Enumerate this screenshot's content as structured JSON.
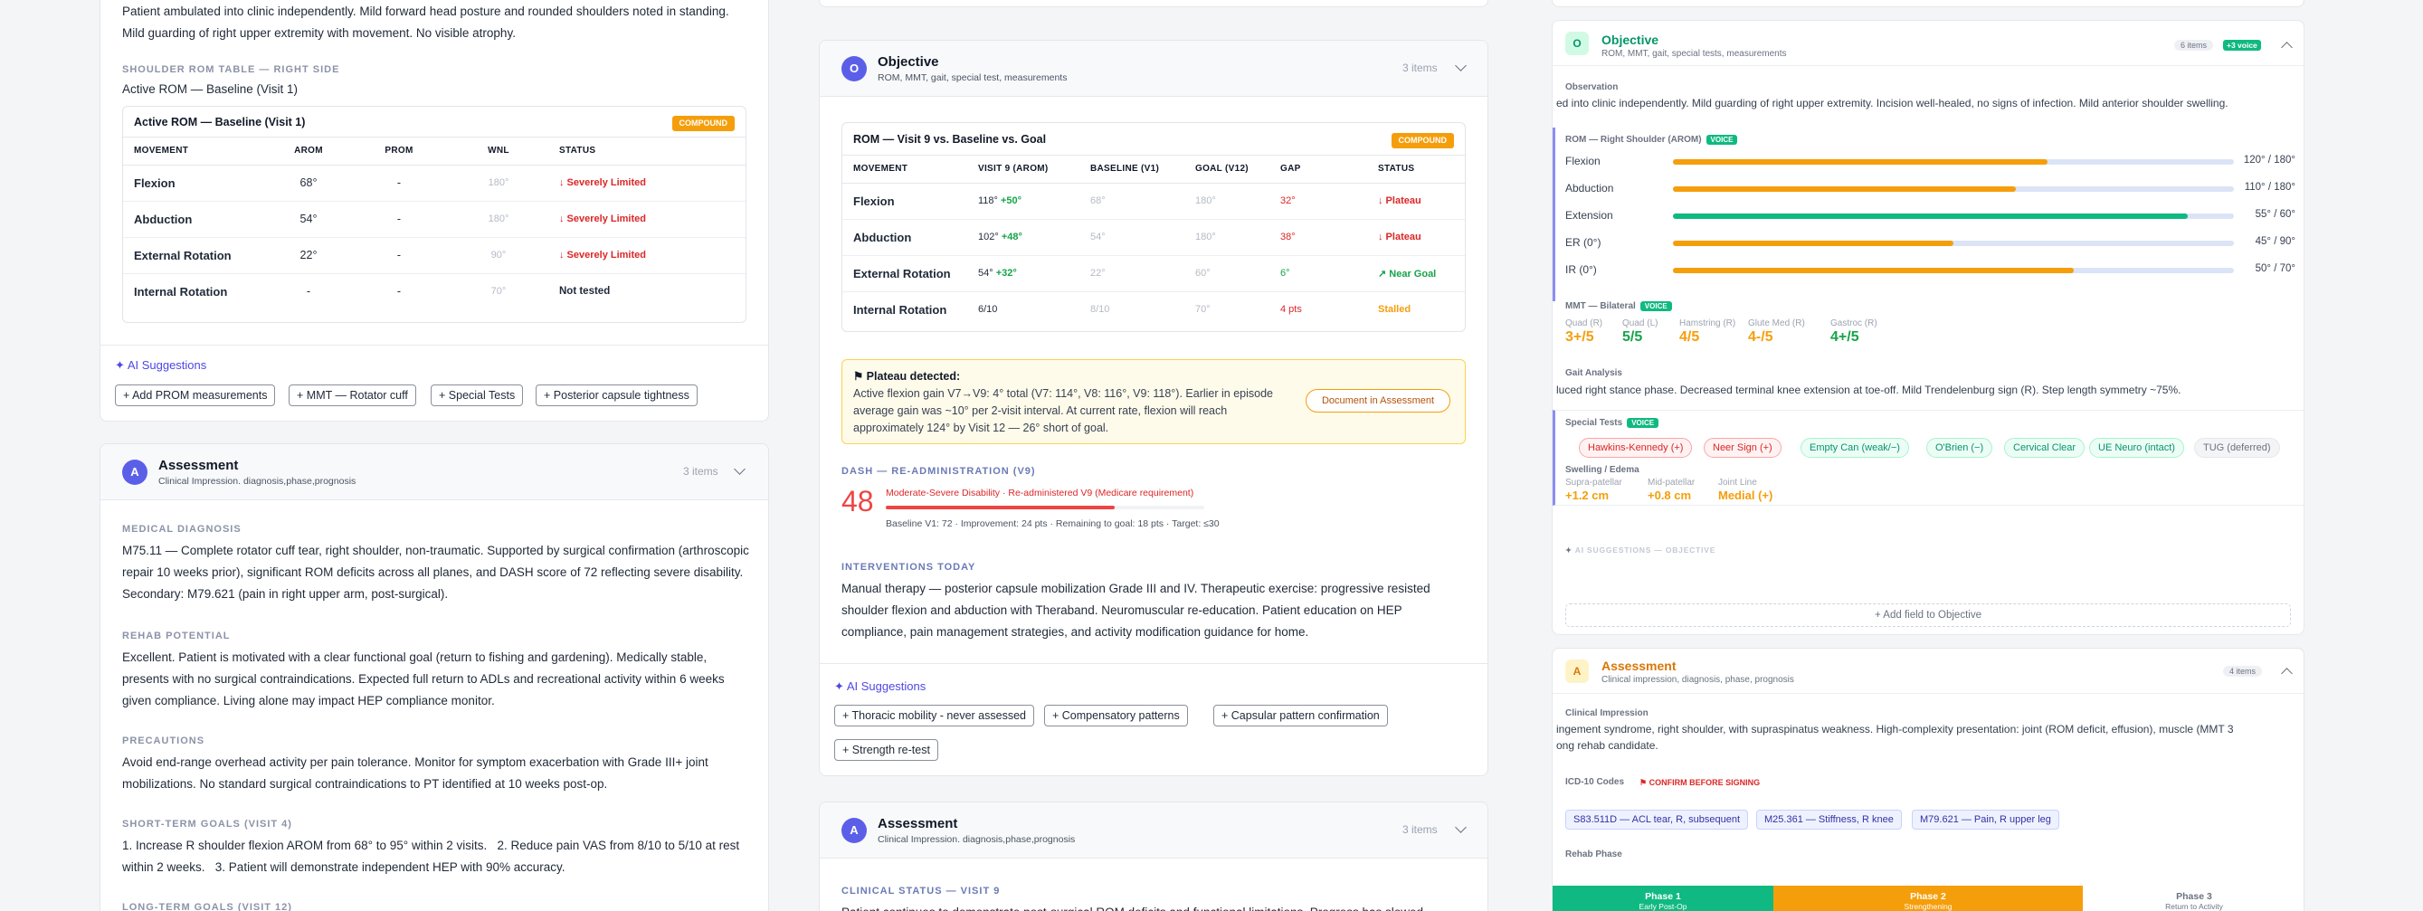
{
  "left": {
    "top_text": "Patient ambulated into clinic independently. Mild forward head posture and rounded shoulders noted in standing. Mild guarding of right upper extremity with movement. No visible atrophy.",
    "rom_label": "SHOULDER ROM TABLE — RIGHT SIDE",
    "rom_subtitle": "Active ROM — Baseline (Visit 1)",
    "table": {
      "caption": "Active ROM — Baseline (Visit 1)",
      "badge": "COMPOUND",
      "headers": [
        "MOVEMENT",
        "AROM",
        "PROM",
        "WNL",
        "STATUS"
      ],
      "rows": [
        {
          "movement": "Flexion",
          "arom": "68°",
          "prom": "-",
          "wnl": "180°",
          "status": "↓ Severely Limited"
        },
        {
          "movement": "Abduction",
          "arom": "54°",
          "prom": "-",
          "wnl": "180°",
          "status": "↓ Severely Limited"
        },
        {
          "movement": "External Rotation",
          "arom": "22°",
          "prom": "-",
          "wnl": "90°",
          "status": "↓ Severely Limited"
        },
        {
          "movement": "Internal Rotation",
          "arom": "-",
          "prom": "-",
          "wnl": "70°",
          "status": "Not tested"
        }
      ]
    },
    "ai_label": "AI Suggestions",
    "chips": [
      "Add PROM measurements",
      "MMT — Rotator cuff",
      "Special Tests",
      "Posterior capsule tightness"
    ],
    "assessment": {
      "avatar": "A",
      "title": "Assessment",
      "subtitle": "Clinical Impression. diagnosis,phase,prognosis",
      "items": "3 items",
      "medical_label": "MEDICAL DIAGNOSIS",
      "medical_text": "M75.11 — Complete rotator cuff tear, right shoulder, non-traumatic. Supported by surgical confirmation (arthroscopic repair 10 weeks prior), significant ROM deficits across all planes, and DASH score of 72 reflecting severe disability. Secondary: M79.621 (pain in right upper arm, post-surgical).",
      "rehab_label": "REHAB POTENTIAL",
      "rehab_text": "Excellent. Patient is motivated with a clear functional goal (return to fishing and gardening). Medically stable, presents with no surgical contraindications. Expected full return to ADLs and recreational activity within 6 weeks given compliance. Living alone may impact HEP compliance monitor.",
      "prec_label": "PRECAUTIONS",
      "prec_text": "Avoid end-range overhead activity per pain tolerance. Monitor for symptom exacerbation with Grade III+ joint mobilizations. No standard surgical contraindications to PT identified at 10 weeks post-op.",
      "stg_label": "SHORT-TERM GOALS (VISIT 4)",
      "stg_text": "1. Increase R shoulder flexion AROM from 68° to 95° within 2 visits.   2. Reduce pain VAS from 8/10 to 5/10 at rest within 2 weeks.   3. Patient will demonstrate independent HEP with 90% accuracy.",
      "ltg_label": "LONG-TERM GOALS (VISIT 12)"
    }
  },
  "middle": {
    "objective": {
      "avatar": "O",
      "title": "Objective",
      "subtitle": "ROM, MMT, gait, special test, measurements",
      "items": "3 items"
    },
    "table": {
      "caption": "ROM — Visit 9 vs. Baseline vs. Goal",
      "badge": "COMPOUND",
      "headers": [
        "MOVEMENT",
        "VISIT 9 (AROM)",
        "BASELINE (V1)",
        "GOAL (V12)",
        "GAP",
        "STATUS"
      ],
      "rows": [
        {
          "movement": "Flexion",
          "v9": "118°",
          "delta": "+50°",
          "baseline": "68°",
          "goal": "180°",
          "gap": "32°",
          "status": "↓ Plateau"
        },
        {
          "movement": "Abduction",
          "v9": "102°",
          "delta": "+48°",
          "baseline": "54°",
          "goal": "180°",
          "gap": "38°",
          "status": "↓ Plateau"
        },
        {
          "movement": "External Rotation",
          "v9": "54°",
          "delta": "+32°",
          "baseline": "22°",
          "goal": "60°",
          "gap": "6°",
          "status": "↗ Near Goal"
        },
        {
          "movement": "Internal Rotation",
          "v9": "6/10",
          "delta": "",
          "baseline": "8/10",
          "goal": "70°",
          "gap": "4 pts",
          "status": "Stalled"
        }
      ]
    },
    "plateau": {
      "title": "⚑ Plateau detected:",
      "text": "Active flexion gain V7→V9: 4° total (V7: 114°, V8: 116°, V9: 118°). Earlier in episode average gain was ~10° per 2-visit interval. At current rate, flexion will reach approximately 124° by Visit 12 — 26° short of goal.",
      "button": "Document in Assessment"
    },
    "dash": {
      "label": "DASH — RE-ADMINISTRATION (V9)",
      "score": "48",
      "progress": 0.72,
      "severity": "Moderate-Severe Disability · Re-administered V9 (Medicare requirement)",
      "detail": "Baseline V1: 72 · Improvement: 24 pts · Remaining to goal: 18 pts · Target: ≤30"
    },
    "interventions_label": "INTERVENTIONS TODAY",
    "interventions_text": "Manual therapy — posterior capsule mobilization Grade III and IV. Therapeutic exercise: progressive resisted shoulder flexion and abduction with Theraband. Neuromuscular re-education. Patient education on HEP compliance, pain management strategies, and activity modification guidance for home.",
    "ai_label": "AI Suggestions",
    "chips": [
      "Thoracic mobility - never assessed",
      "Compensatory patterns",
      "Capsular pattern confirmation",
      "Strength re-test"
    ],
    "assessment": {
      "avatar": "A",
      "title": "Assessment",
      "subtitle": "Clinical Impression. diagnosis,phase,prognosis",
      "items": "3 items",
      "status_label": "CLINICAL STATUS — VISIT 9",
      "status_text": "Patient continues to demonstrate post-surgical ROM deficits and functional limitations. Progress has slowed"
    }
  },
  "right": {
    "objective": {
      "avatar": "O",
      "title": "Objective",
      "subtitle": "ROM, MMT, gait, special tests, measurements",
      "items": "6 items",
      "voice_badge": "+3 voice"
    },
    "observation_label": "Observation",
    "observation_text": "ed into clinic independently. Mild guarding of right upper extremity. Incision well-healed, no signs of infection. Mild anterior shoulder swelling.",
    "rom_title": "ROM — Right Shoulder (AROM)",
    "voice": "VOICE",
    "rom": [
      {
        "name": "Flexion",
        "value": "120° / 180°",
        "pct": 0.667,
        "color": "#f59e0b"
      },
      {
        "name": "Abduction",
        "value": "110° / 180°",
        "pct": 0.611,
        "color": "#f59e0b"
      },
      {
        "name": "Extension",
        "value": "55° / 60°",
        "pct": 0.917,
        "color": "#10b981"
      },
      {
        "name": "ER (0°)",
        "value": "45° / 90°",
        "pct": 0.5,
        "color": "#f59e0b"
      },
      {
        "name": "IR (0°)",
        "value": "50° / 70°",
        "pct": 0.714,
        "color": "#f59e0b"
      }
    ],
    "mmt_title": "MMT — Bilateral",
    "mmt": [
      {
        "name": "Quad (R)",
        "value": "3+/5",
        "color": "#f59e0b"
      },
      {
        "name": "Quad (L)",
        "value": "5/5",
        "color": "#16a34a"
      },
      {
        "name": "Hamstring (R)",
        "value": "4/5",
        "color": "#f59e0b"
      },
      {
        "name": "Glute Med (R)",
        "value": "4-/5",
        "color": "#f59e0b"
      },
      {
        "name": "Gastroc (R)",
        "value": "4+/5",
        "color": "#16a34a"
      }
    ],
    "gait_label": "Gait Analysis",
    "gait_text": "luced right stance phase. Decreased terminal knee extension at toe-off. Mild Trendelenburg sign (R). Step length symmetry ~75%.",
    "special_title": "Special Tests",
    "special_tests": [
      {
        "label": "Hawkins-Kennedy (+)",
        "kind": "pos"
      },
      {
        "label": "Neer Sign (+)",
        "kind": "pos"
      },
      {
        "label": "Empty Can (weak/−)",
        "kind": "neg"
      },
      {
        "label": "O'Brien (−)",
        "kind": "neg"
      },
      {
        "label": "Cervical Clear",
        "kind": "neg"
      },
      {
        "label": "UE Neuro (intact)",
        "kind": "neg"
      },
      {
        "label": "TUG (deferred)",
        "kind": "def"
      }
    ],
    "swelling_label": "Swelling / Edema",
    "swelling": [
      {
        "name": "Supra-patellar",
        "value": "+1.2 cm"
      },
      {
        "name": "Mid-patellar",
        "value": "+0.8 cm"
      },
      {
        "name": "Joint Line",
        "value": "Medial (+)"
      }
    ],
    "ai_label": "AI SUGGESTIONS — OBJECTIVE",
    "add_field": "+ Add field to Objective",
    "assessment": {
      "avatar": "A",
      "title": "Assessment",
      "subtitle": "Clinical impression, diagnosis, phase, prognosis",
      "items": "4 items",
      "ci_label": "Clinical Impression",
      "ci_text1": "ingement syndrome, right shoulder, with supraspinatus weakness. High-complexity presentation: joint (ROM deficit, effusion), muscle (MMT 3",
      "ci_text2": "ong rehab candidate.",
      "icd_label": "ICD-10 Codes",
      "icd_warn": "⚑ CONFIRM BEFORE SIGNING",
      "codes": [
        "S83.511D — ACL tear, R, subsequent",
        "M25.361 — Stiffness, R knee",
        "M79.621 — Pain, R upper leg"
      ],
      "phase_label": "Rehab Phase",
      "phases": [
        {
          "name": "Phase 1",
          "sub": "Early Post-Op"
        },
        {
          "name": "Phase 2",
          "sub": "Strengthening"
        },
        {
          "name": "Phase 3",
          "sub": "Return to Activity"
        }
      ]
    }
  },
  "colors": {
    "accent": "#5b5fe8",
    "orange": "#f59e0b",
    "red": "#dc2626",
    "green": "#10b981"
  }
}
